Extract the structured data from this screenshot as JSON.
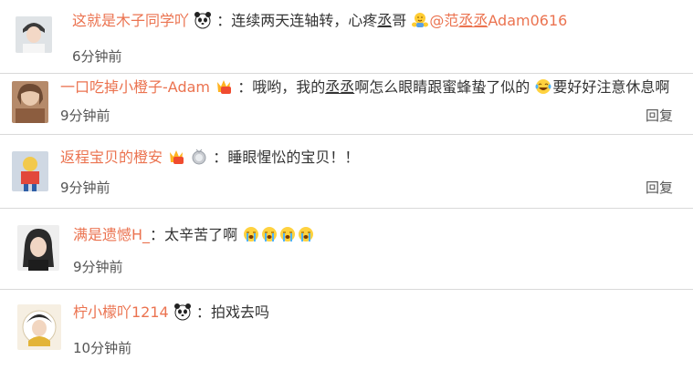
{
  "comments": [
    {
      "username": "这就是木子同学吖",
      "colon": "：",
      "text_a": "连续两天连轴转，心疼",
      "text_b": "丞",
      "text_c": "哥",
      "mention_at": "@范",
      "mention_a": "丞丞",
      "mention_b": "Adam0616",
      "time": "6分钟前",
      "icons": [
        "panda-icon",
        "hug-emoji-icon"
      ]
    },
    {
      "username": "一口吃掉小橙子-Adam",
      "colon": "：",
      "text_a": "哦哟，我的",
      "text_b": "丞丞",
      "text_c": "啊怎么眼睛跟蜜蜂蛰了似的",
      "text_d": "要好好注意休息啊",
      "time": "9分钟前",
      "reply": "回复",
      "icons": [
        "vip-badge-icon",
        "laugh-cry-emoji-icon"
      ]
    },
    {
      "username": "返程宝贝的橙安",
      "colon": "：",
      "text": "睡眼惺忪的宝贝！！",
      "time": "9分钟前",
      "reply": "回复",
      "icons": [
        "vip-badge-icon",
        "medal-icon"
      ]
    },
    {
      "username": "满是遗憾H_",
      "colon": "：",
      "text": "太辛苦了啊",
      "time": "9分钟前",
      "icons": [
        "crying-emoji-icon"
      ]
    },
    {
      "username": "柠小檬吖1214",
      "colon": "：",
      "text": "拍戏去吗",
      "time": "10分钟前",
      "icons": [
        "panda-icon"
      ]
    }
  ],
  "colors": {
    "username": "#eb7350",
    "text": "#333333",
    "time": "#555555",
    "divider": "#d9d9d9"
  }
}
